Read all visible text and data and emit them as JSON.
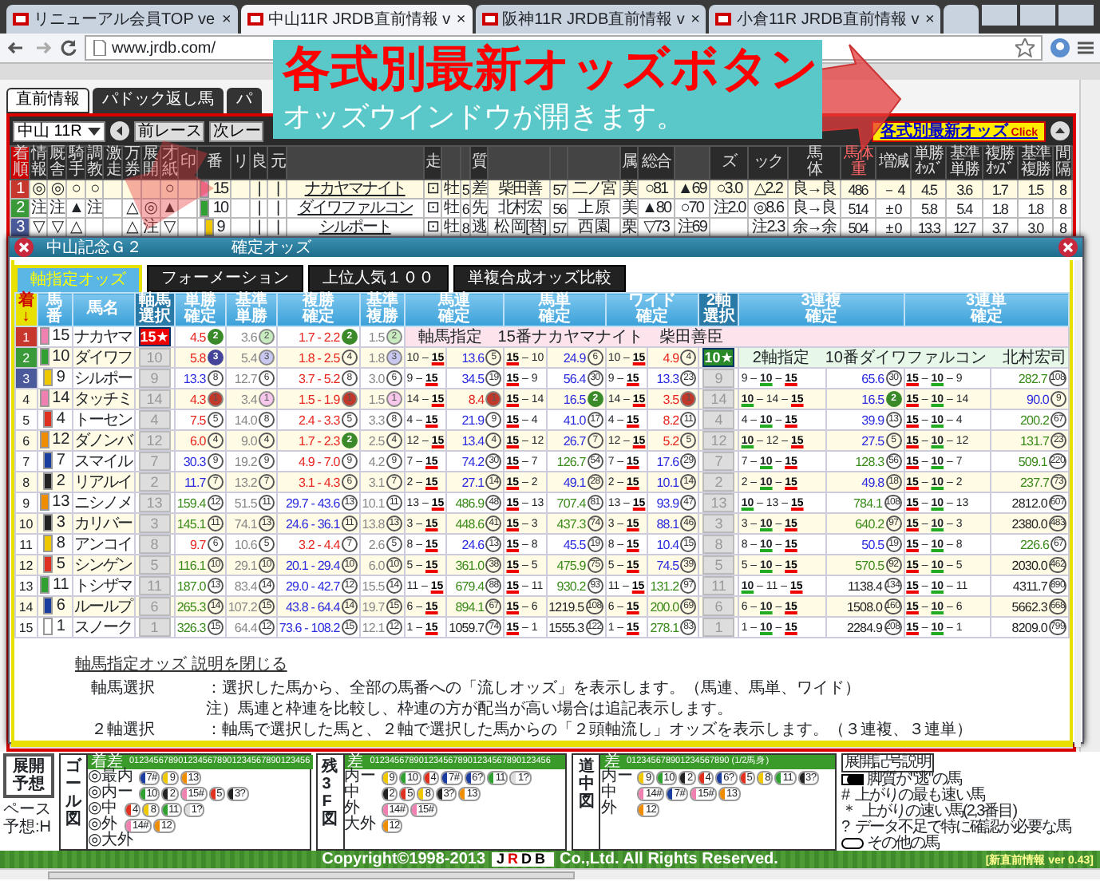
{
  "browser": {
    "tabs": [
      {
        "title": "リニューアル会員TOP ve",
        "selected": false
      },
      {
        "title": "中山11R JRDB直前情報 v",
        "selected": true
      },
      {
        "title": "阪神11R JRDB直前情報 v",
        "selected": false
      },
      {
        "title": "小倉11R JRDB直前情報 v",
        "selected": false
      }
    ],
    "close": "×",
    "url": "www.jrdb.com/"
  },
  "page": {
    "tabs": [
      {
        "label": "直前情報",
        "selected": true
      },
      {
        "label": "パドック返し馬",
        "selected": false
      },
      {
        "label": "パ",
        "selected": false
      }
    ],
    "race_select": "中山 11R",
    "nav_buttons": [
      "前レース",
      "次レー"
    ],
    "odds_button": {
      "label": "各式別最新オッズ",
      "hint": "Click"
    },
    "headers": [
      {
        "lines": [
          "着",
          "順"
        ]
      },
      {
        "lines": [
          "情",
          "報"
        ]
      },
      {
        "lines": [
          "厩",
          "舎"
        ]
      },
      {
        "lines": [
          "騎",
          "手"
        ]
      },
      {
        "lines": [
          "調",
          "教"
        ]
      },
      {
        "lines": [
          "激",
          "走"
        ]
      },
      {
        "lines": [
          "万",
          "券"
        ]
      },
      {
        "lines": [
          "展",
          "開"
        ]
      },
      {
        "lines": [
          "才",
          "紙"
        ]
      },
      {
        "lines": [
          "印"
        ]
      },
      {
        "lines": [
          "番"
        ]
      },
      {
        "lines": [
          "リ"
        ]
      },
      {
        "lines": [
          "良"
        ]
      },
      {
        "lines": [
          "元"
        ]
      },
      {
        "kind": "blank"
      },
      {
        "lines": [
          "走"
        ]
      },
      {
        "kind": "blank"
      },
      {
        "kind": "blank"
      },
      {
        "lines": [
          "質"
        ]
      },
      {
        "kind": "blank"
      },
      {
        "kind": "blank"
      },
      {
        "kind": "blank"
      },
      {
        "lines": [
          "属"
        ]
      },
      {
        "lines": [
          "総合"
        ]
      },
      {
        "kind": "blank"
      },
      {
        "lines": [
          "ズ"
        ]
      },
      {
        "lines": [
          "ック"
        ]
      },
      {
        "lines": [
          "馬",
          "体"
        ]
      },
      {
        "lines": [
          "馬体",
          "重"
        ]
      },
      {
        "lines": [
          "増減"
        ]
      },
      {
        "lines": [
          "単勝",
          "ｵｯｽﾞ"
        ]
      },
      {
        "lines": [
          "基準",
          "単勝"
        ]
      },
      {
        "lines": [
          "複勝",
          "ｵｯｽﾞ"
        ]
      },
      {
        "lines": [
          "基準",
          "複勝"
        ]
      },
      {
        "lines": [
          "間",
          "隔"
        ]
      }
    ],
    "rows": [
      {
        "color": "#c8372d",
        "frame": {
          "color": "#f080b0"
        },
        "cells": [
          "1",
          "◎",
          "◎",
          "○",
          "○",
          null,
          null,
          null,
          "○",
          null,
          "15",
          null,
          "|",
          "|",
          "ナカヤマナイト",
          "⊡",
          "牡",
          "5",
          "差",
          "柴田善",
          "57",
          "二ノ宮",
          "美",
          "○81",
          "▲69",
          "○3.0",
          "△2.2",
          "良→良",
          "486",
          "－ 4",
          "4.5",
          "3.6",
          "1.7",
          "1.5",
          "8"
        ]
      },
      {
        "color": "#3a9a3a",
        "frame": {
          "color": "#30a030"
        },
        "cells": [
          "2",
          "注",
          "注",
          "▲",
          "注",
          null,
          "△",
          "◎",
          "▲",
          null,
          "10",
          null,
          "|",
          "|",
          "ダイワファルコン",
          "⊡",
          "牡",
          "6",
          "先",
          "北村宏",
          "56",
          "上 原",
          "美",
          "▲80",
          "○70",
          "注2.0",
          "◎8.6",
          "良→良",
          "514",
          "± 0",
          "5.8",
          "5.4",
          "1.8",
          "1.8",
          "8"
        ]
      },
      {
        "color": "#4a5a9a",
        "frame": {
          "color": "#f0c800"
        },
        "cells": [
          "3",
          "▽",
          "▽",
          "△",
          null,
          null,
          "△",
          "注",
          "▽",
          null,
          "9",
          null,
          "|",
          "|",
          "シルポート",
          "⊡",
          "牡",
          "8",
          "逃",
          "松 岡[替]",
          "57",
          "西 園",
          "栗",
          "▽73",
          "注69",
          null,
          "注2.3",
          "余→余",
          "504",
          "± 0",
          "13.3",
          "12.7",
          "3.7",
          "3.0",
          "8"
        ]
      }
    ]
  },
  "callout": {
    "title": "各式別最新オッズボタン",
    "subtitle": "オッズウインドウが開きます。"
  },
  "odds_window": {
    "race": "中山記念Ｇ２",
    "title": "確定オッズ",
    "tabs": [
      {
        "label": "軸指定オッズ",
        "selected": true
      },
      {
        "label": "フォーメーション",
        "selected": false
      },
      {
        "label": "上位人気１００",
        "selected": false
      },
      {
        "label": "単複合成オッズ比較",
        "selected": false
      }
    ],
    "headers": [
      {
        "kind": "place",
        "lines": [
          "着",
          "↓"
        ]
      },
      {
        "kind": "single",
        "lines": [
          "馬",
          "番"
        ]
      },
      {
        "kind": "single",
        "lines": [
          "馬名"
        ]
      },
      {
        "kind": "select",
        "lines": [
          "軸馬",
          "選択"
        ]
      },
      {
        "kind": "single",
        "lines": [
          "単勝",
          "確定"
        ]
      },
      {
        "kind": "single",
        "lines": [
          "基準",
          "単勝"
        ]
      },
      {
        "kind": "single",
        "lines": [
          "複勝",
          "確定"
        ]
      },
      {
        "kind": "single",
        "lines": [
          "基準",
          "複勝"
        ]
      },
      {
        "kind": "pair",
        "lines": [
          "馬連",
          "確定"
        ]
      },
      {
        "kind": "pair",
        "lines": [
          "馬単",
          "確定"
        ]
      },
      {
        "kind": "pair",
        "lines": [
          "ワイド",
          "確定"
        ]
      },
      {
        "kind": "select",
        "lines": [
          "2軸",
          "選択"
        ]
      },
      {
        "kind": "pair",
        "lines": [
          "3連複",
          "確定"
        ]
      },
      {
        "kind": "pair",
        "lines": [
          "3連単",
          "確定"
        ]
      }
    ],
    "rows": [
      {
        "place": "1",
        "color": "#c8372d",
        "no": "15",
        "frame": {
          "color": "#f080b0"
        },
        "name": "ナカヤマ",
        "axis": {
          "label": "15★",
          "selected": true
        },
        "win": {
          "odds": "4.5",
          "rank": "2",
          "color": "#e8251f",
          "badge": {
            "color": "#3a8a2a"
          }
        },
        "base_win": {
          "odds": "3.6",
          "rank": "2",
          "color": "#888888",
          "badge": {
            "color": "#c8ecc0"
          }
        },
        "show": {
          "odds": "1.7 - 2.2",
          "rank": "2",
          "color": "#e8251f",
          "badge": {
            "color": "#3a8a2a"
          }
        },
        "base_show": {
          "odds": "1.5",
          "rank": "2",
          "color": "#888888",
          "badge": {
            "color": "#c8ecc0"
          }
        },
        "note": {
          "kind": "axis",
          "text": "軸馬指定　15番ナカヤマナイト　柴田善臣"
        }
      },
      {
        "place": "2",
        "color": "#3a9a3a",
        "no": "10",
        "frame": {
          "color": "#30a030"
        },
        "name": "ダイワフ",
        "axis": {
          "label": "10",
          "selected": false
        },
        "win": {
          "odds": "5.8",
          "rank": "3",
          "color": "#e8251f",
          "badge": {
            "color": "#44449a"
          }
        },
        "base_win": {
          "odds": "5.4",
          "rank": "3",
          "color": "#888888",
          "badge": {
            "color": "#c8c8f0"
          }
        },
        "show": {
          "odds": "1.8 - 2.5",
          "rank": "4",
          "color": "#e8251f"
        },
        "base_show": {
          "odds": "1.8",
          "rank": "3",
          "color": "#888888",
          "badge": {
            "color": "#c8c8f0"
          }
        },
        "quinella": {
          "pair": "10 – **15**",
          "odds": "13.6",
          "rank": "5",
          "color": "#2a2ae0"
        },
        "exacta": {
          "pair": "**15** – 10",
          "odds": "24.9",
          "rank": "6",
          "color": "#2a2ae0"
        },
        "wide": {
          "pair": "10 – **15**",
          "odds": "4.9",
          "rank": "4",
          "color": "#e8251f"
        },
        "second_axis": {
          "label": "10★",
          "selected": true
        },
        "note": {
          "kind": "second_axis",
          "text": "2軸指定　10番ダイワファルコン　北村宏司"
        }
      },
      {
        "place": "3",
        "color": "#4a5a9a",
        "no": "9",
        "frame": {
          "color": "#f0c800"
        },
        "name": "シルポー",
        "axis": {
          "label": "9",
          "selected": false
        },
        "win": {
          "odds": "13.3",
          "rank": "8",
          "color": "#2a2ae0"
        },
        "base_win": {
          "odds": "12.7",
          "rank": "6",
          "color": "#888888"
        },
        "show": {
          "odds": "3.7 - 5.2",
          "rank": "8",
          "color": "#e8251f"
        },
        "base_show": {
          "odds": "3.0",
          "rank": "6",
          "color": "#888888"
        },
        "quinella": {
          "pair": "9 – **15**",
          "odds": "34.5",
          "rank": "19",
          "color": "#2a2ae0"
        },
        "exacta": {
          "pair": "**15** – 9",
          "odds": "56.4",
          "rank": "30",
          "color": "#2a2ae0"
        },
        "wide": {
          "pair": "9 – **15**",
          "odds": "13.3",
          "rank": "23",
          "color": "#2a2ae0"
        },
        "second_axis": {
          "label": "9",
          "selected": false
        },
        "trio": {
          "pair": "9 – *10* – **15**",
          "odds": "65.6",
          "rank": "30",
          "color": "#2a2ae0"
        },
        "trifecta": {
          "pair": "**15** – *10* – 9",
          "odds": "282.7",
          "rank": "108",
          "color": "#3a8a1a"
        }
      },
      {
        "place": "4",
        "no": "14",
        "frame": {
          "color": "#f080b0"
        },
        "name": "タッチミ",
        "axis": {
          "label": "14",
          "selected": false
        },
        "win": {
          "odds": "4.3",
          "rank": "1",
          "color": "#e8251f",
          "badge": {
            "color": "#c0392b"
          }
        },
        "base_win": {
          "odds": "3.4",
          "rank": "1",
          "color": "#888888",
          "badge": {
            "color": "#f8c8ec"
          }
        },
        "show": {
          "odds": "1.5 - 1.9",
          "rank": "1",
          "color": "#e8251f",
          "badge": {
            "color": "#c0392b"
          }
        },
        "base_show": {
          "odds": "1.5",
          "rank": "1",
          "color": "#888888",
          "badge": {
            "color": "#f8c8ec"
          }
        },
        "quinella": {
          "pair": "14 – **15**",
          "odds": "8.4",
          "rank": "1",
          "color": "#e8251f",
          "badge": {
            "color": "#c0392b"
          }
        },
        "exacta": {
          "pair": "**15** – 14",
          "odds": "16.5",
          "rank": "2",
          "color": "#2a2ae0",
          "badge": {
            "color": "#3a8a2a"
          }
        },
        "wide": {
          "pair": "14 – **15**",
          "odds": "3.5",
          "rank": "1",
          "color": "#e8251f",
          "badge": {
            "color": "#c0392b"
          }
        },
        "second_axis": {
          "label": "14",
          "selected": false
        },
        "trio": {
          "pair": "*10* – 14 – **15**",
          "odds": "16.5",
          "rank": "2",
          "color": "#2a2ae0",
          "badge": {
            "color": "#3a8a2a"
          }
        },
        "trifecta": {
          "pair": "**15** – *10* – 14",
          "odds": "90.0",
          "rank": "9",
          "color": "#2a2ae0"
        }
      },
      {
        "place": "5",
        "no": "4",
        "frame": {
          "color": "#e03020"
        },
        "name": "トーセン",
        "axis": {
          "label": "4",
          "selected": false
        },
        "win": {
          "odds": "7.5",
          "rank": "5",
          "color": "#e8251f"
        },
        "base_win": {
          "odds": "14.0",
          "rank": "8",
          "color": "#888888"
        },
        "show": {
          "odds": "2.4 - 3.3",
          "rank": "5",
          "color": "#e8251f"
        },
        "base_show": {
          "odds": "3.3",
          "rank": "8",
          "color": "#888888"
        },
        "quinella": {
          "pair": "4 – **15**",
          "odds": "21.9",
          "rank": "9",
          "color": "#2a2ae0"
        },
        "exacta": {
          "pair": "**15** – 4",
          "odds": "41.0",
          "rank": "17",
          "color": "#2a2ae0"
        },
        "wide": {
          "pair": "4 – **15**",
          "odds": "8.2",
          "rank": "11",
          "color": "#e8251f"
        },
        "second_axis": {
          "label": "4",
          "selected": false
        },
        "trio": {
          "pair": "4 – *10* – **15**",
          "odds": "39.9",
          "rank": "13",
          "color": "#2a2ae0"
        },
        "trifecta": {
          "pair": "**15** – *10* – 4",
          "odds": "200.2",
          "rank": "67",
          "color": "#3a8a1a"
        }
      },
      {
        "place": "6",
        "no": "12",
        "frame": {
          "color": "#f08c00"
        },
        "name": "ダノンバ",
        "axis": {
          "label": "12",
          "selected": false
        },
        "win": {
          "odds": "6.0",
          "rank": "4",
          "color": "#e8251f"
        },
        "base_win": {
          "odds": "9.0",
          "rank": "4",
          "color": "#888888"
        },
        "show": {
          "odds": "1.7 - 2.3",
          "rank": "2",
          "color": "#e8251f",
          "badge": {
            "color": "#3a8a2a"
          }
        },
        "base_show": {
          "odds": "2.5",
          "rank": "4",
          "color": "#888888"
        },
        "quinella": {
          "pair": "12 – **15**",
          "odds": "13.4",
          "rank": "4",
          "color": "#2a2ae0"
        },
        "exacta": {
          "pair": "**15** – 12",
          "odds": "26.7",
          "rank": "7",
          "color": "#2a2ae0"
        },
        "wide": {
          "pair": "12 – **15**",
          "odds": "5.2",
          "rank": "5",
          "color": "#e8251f"
        },
        "second_axis": {
          "label": "12",
          "selected": false
        },
        "trio": {
          "pair": "*10* – 12 – **15**",
          "odds": "27.5",
          "rank": "5",
          "color": "#2a2ae0"
        },
        "trifecta": {
          "pair": "**15** – *10* – 12",
          "odds": "131.7",
          "rank": "23",
          "color": "#3a8a1a"
        }
      },
      {
        "place": "7",
        "no": "7",
        "frame": {
          "color": "#1a3ea0"
        },
        "name": "スマイル",
        "axis": {
          "label": "7",
          "selected": false
        },
        "win": {
          "odds": "30.3",
          "rank": "9",
          "color": "#2a2ae0"
        },
        "base_win": {
          "odds": "19.2",
          "rank": "9",
          "color": "#888888"
        },
        "show": {
          "odds": "4.9 - 7.0",
          "rank": "9",
          "color": "#e8251f"
        },
        "base_show": {
          "odds": "4.2",
          "rank": "9",
          "color": "#888888"
        },
        "quinella": {
          "pair": "7 – **15**",
          "odds": "74.2",
          "rank": "30",
          "color": "#2a2ae0"
        },
        "exacta": {
          "pair": "**15** – 7",
          "odds": "126.7",
          "rank": "54",
          "color": "#3a8a1a"
        },
        "wide": {
          "pair": "7 – **15**",
          "odds": "17.6",
          "rank": "29",
          "color": "#2a2ae0"
        },
        "second_axis": {
          "label": "7",
          "selected": false
        },
        "trio": {
          "pair": "7 – *10* – **15**",
          "odds": "128.3",
          "rank": "56",
          "color": "#3a8a1a"
        },
        "trifecta": {
          "pair": "**15** – *10* – 7",
          "odds": "509.1",
          "rank": "220",
          "color": "#3a8a1a"
        }
      },
      {
        "place": "8",
        "no": "2",
        "frame": {
          "color": "#222222"
        },
        "name": "リアルイ",
        "axis": {
          "label": "2",
          "selected": false
        },
        "win": {
          "odds": "11.7",
          "rank": "7",
          "color": "#2a2ae0"
        },
        "base_win": {
          "odds": "13.2",
          "rank": "7",
          "color": "#888888"
        },
        "show": {
          "odds": "3.1 - 4.3",
          "rank": "6",
          "color": "#e8251f"
        },
        "base_show": {
          "odds": "3.1",
          "rank": "7",
          "color": "#888888"
        },
        "quinella": {
          "pair": "2 – **15**",
          "odds": "27.1",
          "rank": "14",
          "color": "#2a2ae0"
        },
        "exacta": {
          "pair": "**15** – 2",
          "odds": "49.1",
          "rank": "28",
          "color": "#2a2ae0"
        },
        "wide": {
          "pair": "2 – **15**",
          "odds": "10.1",
          "rank": "14",
          "color": "#2a2ae0"
        },
        "second_axis": {
          "label": "2",
          "selected": false
        },
        "trio": {
          "pair": "2 – *10* – **15**",
          "odds": "49.8",
          "rank": "18",
          "color": "#2a2ae0"
        },
        "trifecta": {
          "pair": "**15** – *10* – 2",
          "odds": "237.7",
          "rank": "73",
          "color": "#3a8a1a"
        }
      },
      {
        "place": "9",
        "no": "13",
        "frame": {
          "color": "#f08c00"
        },
        "name": "ニシノメ",
        "axis": {
          "label": "13",
          "selected": false
        },
        "win": {
          "odds": "159.4",
          "rank": "12",
          "color": "#3a8a1a"
        },
        "base_win": {
          "odds": "51.5",
          "rank": "11",
          "color": "#888888"
        },
        "show": {
          "odds": "29.7 - 43.6",
          "rank": "13",
          "color": "#2a2ae0"
        },
        "base_show": {
          "odds": "10.1",
          "rank": "11",
          "color": "#888888"
        },
        "quinella": {
          "pair": "13 – **15**",
          "odds": "486.9",
          "rank": "48",
          "color": "#3a8a1a"
        },
        "exacta": {
          "pair": "**15** – 13",
          "odds": "707.4",
          "rank": "81",
          "color": "#3a8a1a"
        },
        "wide": {
          "pair": "13 – **15**",
          "odds": "93.9",
          "rank": "47",
          "color": "#2a2ae0"
        },
        "second_axis": {
          "label": "13",
          "selected": false
        },
        "trio": {
          "pair": "*10* – 13 – **15**",
          "odds": "784.1",
          "rank": "108",
          "color": "#3a8a1a"
        },
        "trifecta": {
          "pair": "**15** – *10* – 13",
          "odds": "2812.0",
          "rank": "607",
          "color": "#222222"
        }
      },
      {
        "place": "10",
        "no": "3",
        "frame": {
          "color": "#222222"
        },
        "name": "カリバー",
        "axis": {
          "label": "3",
          "selected": false
        },
        "win": {
          "odds": "145.1",
          "rank": "11",
          "color": "#3a8a1a"
        },
        "base_win": {
          "odds": "74.1",
          "rank": "13",
          "color": "#888888"
        },
        "show": {
          "odds": "24.6 - 36.1",
          "rank": "11",
          "color": "#2a2ae0"
        },
        "base_show": {
          "odds": "13.8",
          "rank": "13",
          "color": "#888888"
        },
        "quinella": {
          "pair": "3 – **15**",
          "odds": "448.6",
          "rank": "41",
          "color": "#3a8a1a"
        },
        "exacta": {
          "pair": "**15** – 3",
          "odds": "437.3",
          "rank": "74",
          "color": "#3a8a1a"
        },
        "wide": {
          "pair": "3 – **15**",
          "odds": "88.1",
          "rank": "46",
          "color": "#2a2ae0"
        },
        "second_axis": {
          "label": "3",
          "selected": false
        },
        "trio": {
          "pair": "3 – *10* – **15**",
          "odds": "640.2",
          "rank": "97",
          "color": "#3a8a1a"
        },
        "trifecta": {
          "pair": "**15** – *10* – 3",
          "odds": "2380.0",
          "rank": "483",
          "color": "#222222"
        }
      },
      {
        "place": "11",
        "no": "8",
        "frame": {
          "color": "#f0c800"
        },
        "name": "アンコイ",
        "axis": {
          "label": "8",
          "selected": false
        },
        "win": {
          "odds": "9.7",
          "rank": "6",
          "color": "#e8251f"
        },
        "base_win": {
          "odds": "10.6",
          "rank": "5",
          "color": "#888888"
        },
        "show": {
          "odds": "3.2 - 4.4",
          "rank": "7",
          "color": "#e8251f"
        },
        "base_show": {
          "odds": "2.6",
          "rank": "5",
          "color": "#888888"
        },
        "quinella": {
          "pair": "8 – **15**",
          "odds": "24.6",
          "rank": "13",
          "color": "#2a2ae0"
        },
        "exacta": {
          "pair": "**15** – 8",
          "odds": "45.5",
          "rank": "19",
          "color": "#2a2ae0"
        },
        "wide": {
          "pair": "8 – **15**",
          "odds": "10.4",
          "rank": "15",
          "color": "#2a2ae0"
        },
        "second_axis": {
          "label": "8",
          "selected": false
        },
        "trio": {
          "pair": "8 – *10* – **15**",
          "odds": "50.5",
          "rank": "19",
          "color": "#2a2ae0"
        },
        "trifecta": {
          "pair": "**15** – *10* – 8",
          "odds": "226.6",
          "rank": "67",
          "color": "#3a8a1a"
        }
      },
      {
        "place": "12",
        "no": "5",
        "frame": {
          "color": "#e03020"
        },
        "name": "シンゲン",
        "axis": {
          "label": "5",
          "selected": false
        },
        "win": {
          "odds": "116.1",
          "rank": "10",
          "color": "#3a8a1a"
        },
        "base_win": {
          "odds": "29.1",
          "rank": "10",
          "color": "#888888"
        },
        "show": {
          "odds": "20.1 - 29.4",
          "rank": "10",
          "color": "#2a2ae0"
        },
        "base_show": {
          "odds": "6.0",
          "rank": "10",
          "color": "#888888"
        },
        "quinella": {
          "pair": "5 – **15**",
          "odds": "361.0",
          "rank": "38",
          "color": "#3a8a1a"
        },
        "exacta": {
          "pair": "**15** – 5",
          "odds": "475.9",
          "rank": "75",
          "color": "#3a8a1a"
        },
        "wide": {
          "pair": "5 – **15**",
          "odds": "74.5",
          "rank": "39",
          "color": "#2a2ae0"
        },
        "second_axis": {
          "label": "5",
          "selected": false
        },
        "trio": {
          "pair": "5 – *10* – **15**",
          "odds": "570.5",
          "rank": "92",
          "color": "#3a8a1a"
        },
        "trifecta": {
          "pair": "**15** – *10* – 5",
          "odds": "2030.0",
          "rank": "462",
          "color": "#222222"
        }
      },
      {
        "place": "13",
        "no": "11",
        "frame": {
          "color": "#30a030"
        },
        "name": "トシザマ",
        "axis": {
          "label": "11",
          "selected": false
        },
        "win": {
          "odds": "187.0",
          "rank": "13",
          "color": "#3a8a1a"
        },
        "base_win": {
          "odds": "83.4",
          "rank": "14",
          "color": "#888888"
        },
        "show": {
          "odds": "29.0 - 42.7",
          "rank": "12",
          "color": "#2a2ae0"
        },
        "base_show": {
          "odds": "15.5",
          "rank": "14",
          "color": "#888888"
        },
        "quinella": {
          "pair": "11 – **15**",
          "odds": "679.4",
          "rank": "88",
          "color": "#3a8a1a"
        },
        "exacta": {
          "pair": "**15** – 11",
          "odds": "930.2",
          "rank": "93",
          "color": "#3a8a1a"
        },
        "wide": {
          "pair": "11 – **15**",
          "odds": "131.2",
          "rank": "97",
          "color": "#3a8a1a"
        },
        "second_axis": {
          "label": "11",
          "selected": false
        },
        "trio": {
          "pair": "*10* – 11 – **15**",
          "odds": "1138.4",
          "rank": "134",
          "color": "#222222"
        },
        "trifecta": {
          "pair": "**15** – *10* – 11",
          "odds": "4311.7",
          "rank": "890",
          "color": "#222222"
        }
      },
      {
        "place": "14",
        "no": "6",
        "frame": {
          "color": "#1a3ea0"
        },
        "name": "ルールプ",
        "axis": {
          "label": "6",
          "selected": false
        },
        "win": {
          "odds": "265.3",
          "rank": "14",
          "color": "#3a8a1a"
        },
        "base_win": {
          "odds": "107.2",
          "rank": "15",
          "color": "#888888"
        },
        "show": {
          "odds": "43.8 - 64.4",
          "rank": "14",
          "color": "#2a2ae0"
        },
        "base_show": {
          "odds": "19.7",
          "rank": "15",
          "color": "#888888"
        },
        "quinella": {
          "pair": "6 – **15**",
          "odds": "894.1",
          "rank": "67",
          "color": "#3a8a1a"
        },
        "exacta": {
          "pair": "**15** – 6",
          "odds": "1219.5",
          "rank": "108",
          "color": "#222222"
        },
        "wide": {
          "pair": "6 – **15**",
          "odds": "200.0",
          "rank": "69",
          "color": "#3a8a1a"
        },
        "second_axis": {
          "label": "6",
          "selected": false
        },
        "trio": {
          "pair": "6 – *10* – **15**",
          "odds": "1508.0",
          "rank": "160",
          "color": "#222222"
        },
        "trifecta": {
          "pair": "**15** – *10* – 6",
          "odds": "5662.3",
          "rank": "668",
          "color": "#222222"
        }
      },
      {
        "place": "15",
        "no": "1",
        "frame": {
          "color": "#ffffff"
        },
        "name": "スノーク",
        "axis": {
          "label": "1",
          "selected": false
        },
        "win": {
          "odds": "326.3",
          "rank": "15",
          "color": "#3a8a1a"
        },
        "base_win": {
          "odds": "64.4",
          "rank": "12",
          "color": "#888888"
        },
        "show": {
          "odds": "73.6 - 108.2",
          "rank": "15",
          "color": "#2a2ae0"
        },
        "base_show": {
          "odds": "12.1",
          "rank": "12",
          "color": "#888888"
        },
        "quinella": {
          "pair": "1 – **15**",
          "odds": "1059.7",
          "rank": "74",
          "color": "#222222"
        },
        "exacta": {
          "pair": "**15** – 1",
          "odds": "1555.3",
          "rank": "122",
          "color": "#222222"
        },
        "wide": {
          "pair": "1 – **15**",
          "odds": "278.1",
          "rank": "83",
          "color": "#3a8a1a"
        },
        "second_axis": {
          "label": "1",
          "selected": false
        },
        "trio": {
          "pair": "1 – *10* – **15**",
          "odds": "2284.9",
          "rank": "208",
          "color": "#222222"
        },
        "trifecta": {
          "pair": "**15** – *10* – 1",
          "odds": "8209.0",
          "rank": "799",
          "color": "#222222"
        }
      }
    ],
    "explanation": {
      "toggle": "軸馬指定オッズ 説明を閉じる",
      "lines": [
        {
          "kind": "term",
          "term": "軸馬選択",
          "text": "：選択した馬から、全部の馬番への「流しオッズ」を表示します。（馬連、馬単、ワイド）"
        },
        {
          "kind": "note",
          "text": "注）馬連と枠連を比較し、枠連の方が配当が高い場合は追記表示します。"
        },
        {
          "kind": "term",
          "term": "２軸選択",
          "text": "：軸馬で選択した馬と、２軸で選択した馬からの「２頭軸流し」オッズを表示します。（３連複、３連単）"
        }
      ]
    }
  },
  "forecast": {
    "button": "展開予想",
    "pace": "ペース予想:H",
    "charts": [
      {
        "title": "ゴール図",
        "scale_label": "着差",
        "scale": "0123456789012345678901234567890123456",
        "lanes": [
          {
            "label": "◎最内",
            "tokens": [
              {
                "label": "7#",
                "color": "#1a3ea0"
              },
              {
                "label": "9",
                "color": "#f0c800"
              },
              {
                "label": "13",
                "color": "#f08c00"
              }
            ]
          },
          {
            "label": "◎内ー",
            "tokens": [
              {
                "label": "10",
                "color": "#30a030"
              },
              {
                "label": "2",
                "color": "#222222"
              },
              {
                "label": "15#",
                "color": "#f080b0"
              },
              {
                "label": "5",
                "color": "#e03020"
              },
              {
                "label": "3?",
                "color": "#222222"
              }
            ]
          },
          {
            "label": "◎中",
            "tokens": [
              {
                "label": "4",
                "color": "#e03020"
              },
              {
                "label": "8",
                "color": "#f0c800"
              },
              {
                "label": "11",
                "color": "#30a030"
              },
              {
                "label": "1?",
                "color": "#dddddd"
              }
            ]
          },
          {
            "label": "◎外",
            "tokens": [
              {
                "label": "14#",
                "color": "#f080b0"
              },
              {
                "label": "12",
                "color": "#f08c00"
              }
            ]
          },
          {
            "label": "◎大外"
          }
        ]
      },
      {
        "title": "残3F図",
        "scale_label": "差",
        "scale": "0123456789012345678901234567890123456",
        "lanes": [
          {
            "label": "内ー",
            "tokens": [
              {
                "label": "9",
                "color": "#f0c800"
              },
              {
                "label": "10",
                "color": "#30a030"
              },
              {
                "label": "4",
                "color": "#e03020"
              },
              {
                "label": "7#",
                "color": "#1a3ea0"
              },
              {
                "label": "6?",
                "color": "#1a3ea0"
              },
              {
                "label": "11",
                "color": "#30a030"
              },
              {
                "label": "1?",
                "color": "#dddddd"
              }
            ]
          },
          {
            "label": "中",
            "tokens": [
              {
                "label": "2",
                "color": "#222222"
              },
              {
                "label": "5",
                "color": "#e03020"
              },
              {
                "label": "8",
                "color": "#f0c800"
              },
              {
                "label": "3?",
                "color": "#222222"
              },
              {
                "label": "13",
                "color": "#f08c00"
              }
            ]
          },
          {
            "label": "外",
            "tokens": [
              {
                "label": "14#",
                "color": "#f080b0"
              },
              {
                "label": "15#",
                "color": "#f080b0"
              }
            ]
          },
          {
            "label": "大外",
            "tokens": [
              {
                "label": "12",
                "color": "#f08c00"
              }
            ]
          }
        ]
      },
      {
        "title": "道中図",
        "scale_label": "差",
        "scale": "012345678901234567890 (1/2馬身)",
        "lanes": [
          {
            "label": "内ー",
            "tokens": [
              {
                "label": "9",
                "color": "#f0c800"
              },
              {
                "label": "10",
                "color": "#30a030"
              },
              {
                "label": "2",
                "color": "#222222"
              },
              {
                "label": "4",
                "color": "#e03020"
              },
              {
                "label": "6?",
                "color": "#1a3ea0"
              },
              {
                "label": "5",
                "color": "#e03020"
              },
              {
                "label": "8",
                "color": "#f0c800"
              },
              {
                "label": "11",
                "color": "#30a030"
              },
              {
                "label": "3?",
                "color": "#222222"
              }
            ]
          },
          {
            "label": "中",
            "tokens": [
              {
                "label": "14#",
                "color": "#f080b0"
              },
              {
                "label": "7#",
                "color": "#1a3ea0"
              },
              {
                "label": "15#",
                "color": "#f080b0"
              },
              {
                "label": "13",
                "color": "#f08c00"
              }
            ]
          },
          {
            "label": "外",
            "tokens": [
              {
                "label": "12",
                "color": "#f08c00"
              }
            ]
          }
        ]
      }
    ],
    "legend": {
      "title": "展開記号説明",
      "items": [
        {
          "kind": "front",
          "text": "脚質が\"逃\"の馬"
        },
        {
          "kind": "mark",
          "mark": "#",
          "text": "上がりの最も速い馬"
        },
        {
          "kind": "mark",
          "mark": "＊",
          "text": "上がりの速い馬(2,3番目)"
        },
        {
          "kind": "mark",
          "mark": "?",
          "text": "データ不足で特に確認が必要な馬"
        },
        {
          "kind": "other",
          "text": "その他の馬"
        }
      ]
    }
  },
  "footer": {
    "copyright": "Copyright©1998-2013",
    "logo": "J**R**DB",
    "rights": "Co.,Ltd. All Rights Reserved.",
    "version": "[新直前情報 ver 0.43]"
  }
}
